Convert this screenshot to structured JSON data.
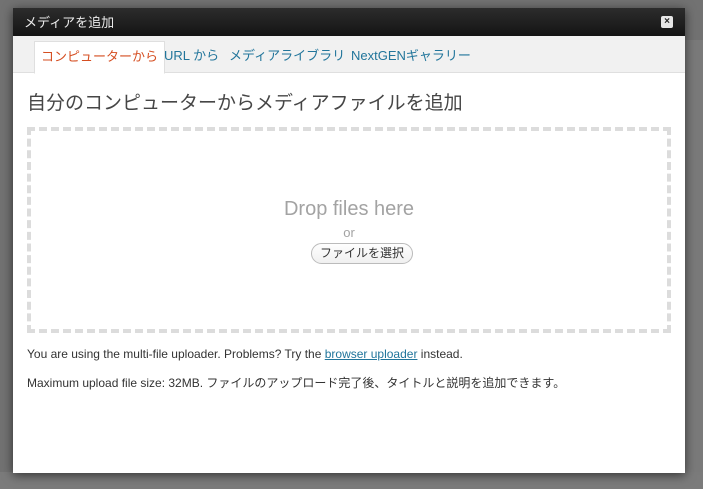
{
  "modal": {
    "title": "メディアを追加",
    "close_icon": "close-icon"
  },
  "tabs": [
    {
      "label": "コンピューターから",
      "active": true
    },
    {
      "label": "URL から",
      "active": false
    },
    {
      "label": "メディアライブラリ",
      "active": false
    },
    {
      "label": "NextGENギャラリー",
      "active": false
    }
  ],
  "main": {
    "heading": "自分のコンピューターからメディアファイルを追加",
    "drop_text": "Drop files here",
    "or_text": "or",
    "select_button": "ファイルを選択",
    "uploader_prefix": "You are using the multi-file uploader. Problems? Try the ",
    "uploader_link": "browser uploader",
    "uploader_suffix": " instead.",
    "max_size_line": "Maximum upload file size: 32MB. ファイルのアップロード完了後、タイトルと説明を追加できます。"
  },
  "colors": {
    "accent_link": "#21759b",
    "active_tab": "#d54e21",
    "header_bg": "#1f1f1f"
  }
}
